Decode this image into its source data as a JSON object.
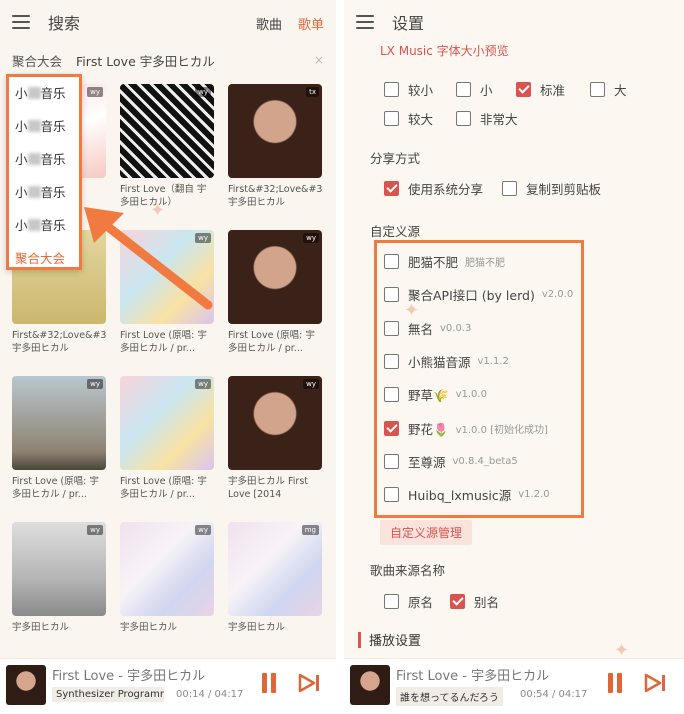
{
  "colors": {
    "accent": "#e06a3a",
    "highlight_box": "#f07a3f",
    "checkbox_on": "#d9534f"
  },
  "left": {
    "header": {
      "title": "搜索",
      "tabs": [
        {
          "label": "歌曲"
        },
        {
          "label": "歌单"
        }
      ]
    },
    "source_bar": {
      "source": "聚合大会",
      "query": "First Love  宇多田ヒカル",
      "clear": "×"
    },
    "dropdown": {
      "items": [
        "小",
        "小",
        "小",
        "小",
        "小",
        "聚合大会"
      ],
      "item_suffix": "音乐"
    },
    "cards": [
      {
        "title": "",
        "badge": "wy",
        "cover": "c-pink"
      },
      {
        "title": "First Love（翻自 宇多田ヒカル）",
        "badge": "wy",
        "cover": "c-bw"
      },
      {
        "title": "First&#32;Love&#32;宇多田ヒカル",
        "badge": "tx",
        "cover": "c-face"
      },
      {
        "title": "First&#32;Love&#32;宇多田ヒカル",
        "badge": "",
        "cover": "c-yellow"
      },
      {
        "title": "First Love (原唱: 宇多田ヒカル / pr...",
        "badge": "wy",
        "cover": "c-color"
      },
      {
        "title": "First Love (原唱: 宇多田ヒカル / pr...",
        "badge": "wy",
        "cover": "c-face"
      },
      {
        "title": "First Love (原唱: 宇多田ヒカル / pr...",
        "badge": "wy",
        "cover": "c-sky"
      },
      {
        "title": "First Love (原唱: 宇多田ヒカル / pr...",
        "badge": "wy",
        "cover": "c-color"
      },
      {
        "title": "宇多田ヒカル First Love [2014",
        "badge": "wy",
        "cover": "c-face"
      },
      {
        "title": "宇多田ヒカル",
        "badge": "wy",
        "cover": "c-build"
      },
      {
        "title": "宇多田ヒカル",
        "badge": "wy",
        "cover": "c-pastel"
      },
      {
        "title": "宇多田ヒカル",
        "badge": "mg",
        "cover": "c-pastel"
      }
    ],
    "player": {
      "song": "First Love - 宇多田ヒカル",
      "sub": "Synthesizer Programmi...",
      "time": "00:14 / 04:17"
    }
  },
  "right": {
    "header": {
      "title": "设置"
    },
    "font_preview": "LX Music 字体大小预览",
    "font_sizes": [
      {
        "label": "较小",
        "checked": false
      },
      {
        "label": "小",
        "checked": false
      },
      {
        "label": "标准",
        "checked": true
      },
      {
        "label": "大",
        "checked": false
      },
      {
        "label": "较大",
        "checked": false
      },
      {
        "label": "非常大",
        "checked": false
      }
    ],
    "share": {
      "label": "分享方式",
      "options": [
        {
          "label": "使用系统分享",
          "checked": true
        },
        {
          "label": "复制到剪贴板",
          "checked": false
        }
      ]
    },
    "custom_sources": {
      "label": "自定义源",
      "items": [
        {
          "name": "肥猫不肥",
          "version": "肥猫不肥",
          "checked": false
        },
        {
          "name": "聚合API接口 (by lerd)",
          "version": "v2.0.0",
          "checked": false
        },
        {
          "name": "無名",
          "version": "v0.0.3",
          "checked": false
        },
        {
          "name": "小熊猫音源",
          "version": "v1.1.2",
          "checked": false
        },
        {
          "name": "野草🌾",
          "version": "v1.0.0",
          "checked": false
        },
        {
          "name": "野花🌷",
          "version": "v1.0.0 [初始化成功]",
          "checked": true
        },
        {
          "name": "至尊源",
          "version": "v0.8.4_beta5",
          "checked": false
        },
        {
          "name": "Huibq_lxmusic源",
          "version": "v1.2.0",
          "checked": false
        }
      ],
      "manage_button": "自定义源管理"
    },
    "source_name": {
      "label": "歌曲来源名称",
      "options": [
        {
          "label": "原名",
          "checked": false
        },
        {
          "label": "别名",
          "checked": true
        }
      ]
    },
    "playback_section": "播放设置",
    "player": {
      "song": "First Love - 宇多田ヒカル",
      "sub": "誰を想ってるんだろう",
      "time": "00:54 / 04:17"
    }
  }
}
